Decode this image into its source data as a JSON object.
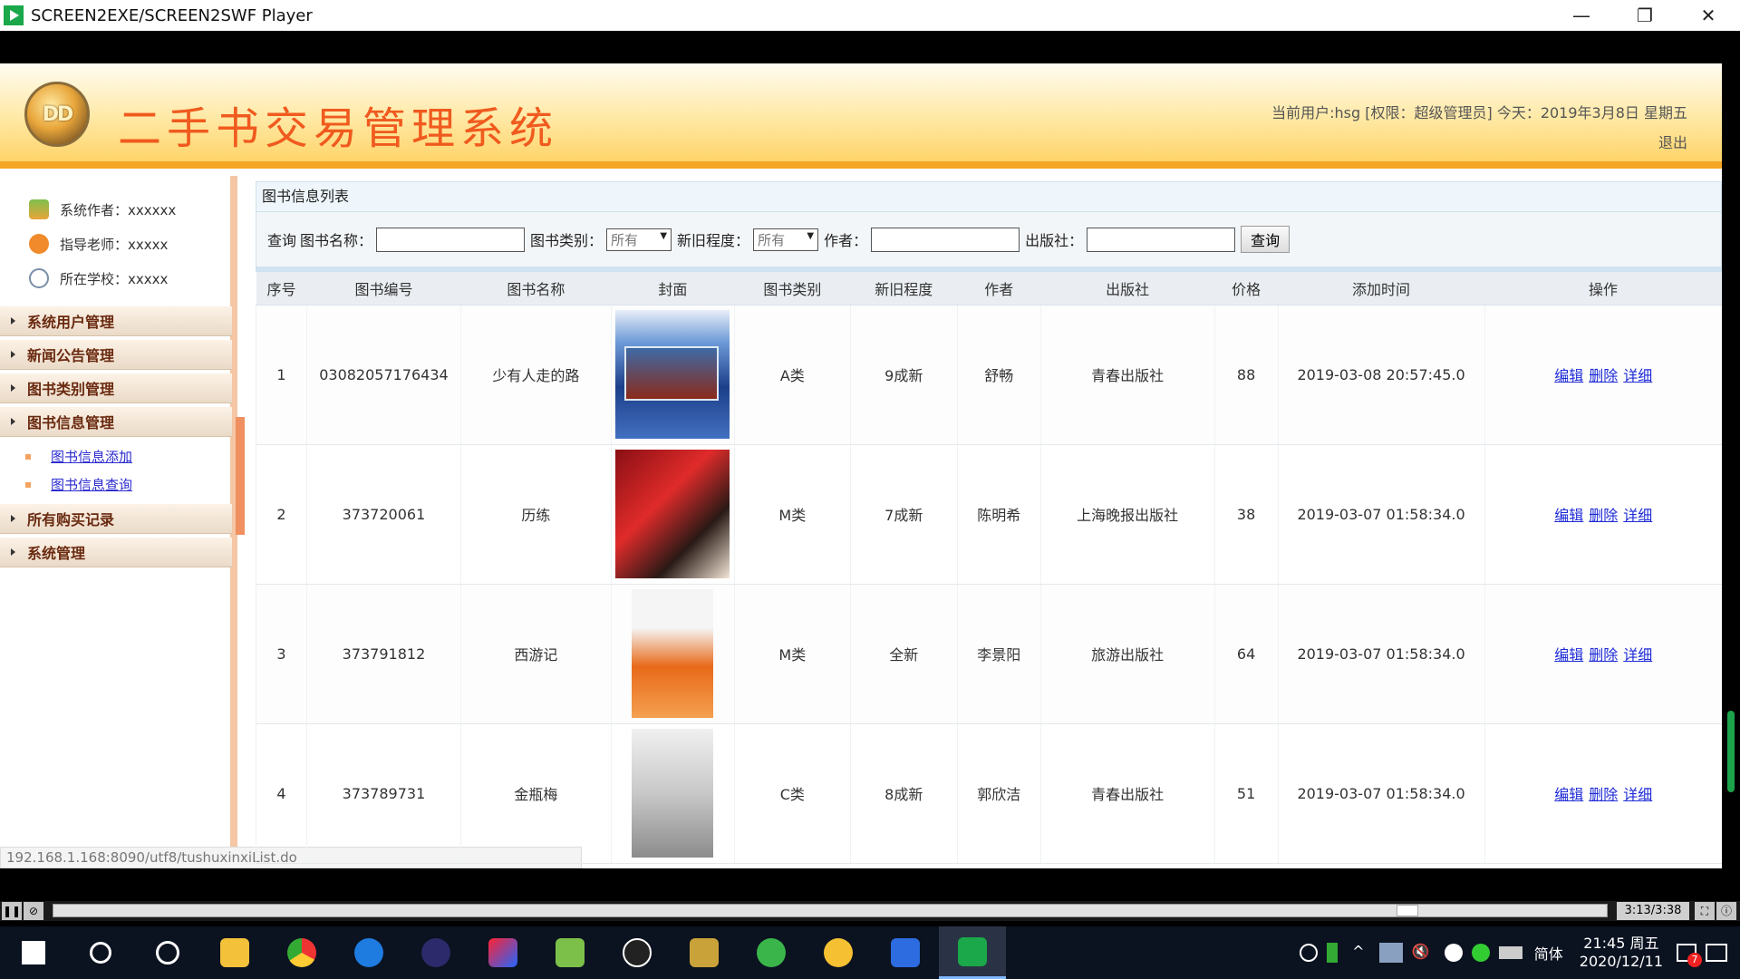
{
  "window": {
    "title": "SCREEN2EXE/SCREEN2SWF Player",
    "min": "—",
    "restore": "❐",
    "close": "✕"
  },
  "header": {
    "logo_text": "DD",
    "system_title": "二手书交易管理系统",
    "user_info": "当前用户:hsg [权限：超级管理员] 今天：2019年3月8日 星期五",
    "logout": "退出"
  },
  "sidebar": {
    "info": [
      {
        "label": "系统作者：xxxxxx"
      },
      {
        "label": "指导老师：xxxxx"
      },
      {
        "label": "所在学校：xxxxx"
      }
    ],
    "menu": [
      {
        "label": "系统用户管理"
      },
      {
        "label": "新闻公告管理"
      },
      {
        "label": "图书类别管理"
      },
      {
        "label": "图书信息管理"
      },
      {
        "label": "所有购买记录"
      },
      {
        "label": "系统管理"
      }
    ],
    "submenu": [
      {
        "label": "图书信息添加"
      },
      {
        "label": "图书信息查询"
      }
    ]
  },
  "status_url": "192.168.1.168:8090/utf8/tushuxinxiList.do",
  "panel": {
    "title": "图书信息列表"
  },
  "search": {
    "prefix": "查询",
    "name_label": "图书名称：",
    "category_label": "图书类别：",
    "category_value": "所有",
    "condition_label": "新旧程度：",
    "condition_value": "所有",
    "author_label": "作者：",
    "publisher_label": "出版社：",
    "button": "查询"
  },
  "table": {
    "headers": [
      "序号",
      "图书编号",
      "图书名称",
      "封面",
      "图书类别",
      "新旧程度",
      "作者",
      "出版社",
      "价格",
      "添加时间",
      "操作"
    ],
    "ops": {
      "edit": "编辑",
      "delete": "删除",
      "detail": "详细"
    },
    "rows": [
      {
        "no": "1",
        "code": "03082057176434",
        "name": "少有人走的路",
        "category": "A类",
        "condition": "9成新",
        "author": "舒畅",
        "publisher": "青春出版社",
        "price": "88",
        "time": "2019-03-08 20:57:45.0"
      },
      {
        "no": "2",
        "code": "373720061",
        "name": "历练",
        "category": "M类",
        "condition": "7成新",
        "author": "陈明希",
        "publisher": "上海晚报出版社",
        "price": "38",
        "time": "2019-03-07 01:58:34.0"
      },
      {
        "no": "3",
        "code": "373791812",
        "name": "西游记",
        "category": "M类",
        "condition": "全新",
        "author": "李景阳",
        "publisher": "旅游出版社",
        "price": "64",
        "time": "2019-03-07 01:58:34.0"
      },
      {
        "no": "4",
        "code": "373789731",
        "name": "金瓶梅",
        "category": "C类",
        "condition": "8成新",
        "author": "郭欣洁",
        "publisher": "青春出版社",
        "price": "51",
        "time": "2019-03-07 01:58:34.0"
      }
    ]
  },
  "player": {
    "time": "3:13/3:38",
    "progress": 0.877
  },
  "taskbar": {
    "ime": "简体",
    "time": "21:45 周五",
    "date": "2020/12/11",
    "notification_count": "7"
  }
}
